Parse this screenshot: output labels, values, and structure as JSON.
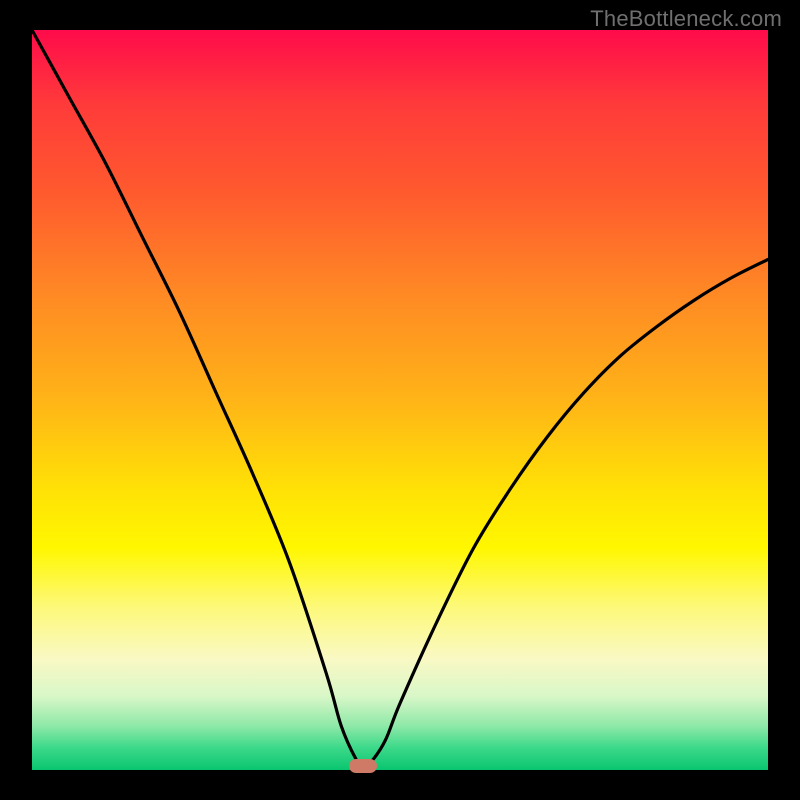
{
  "watermark": {
    "text": "TheBottleneck.com"
  },
  "chart_data": {
    "type": "line",
    "title": "",
    "xlabel": "",
    "ylabel": "",
    "xlim": [
      0,
      100
    ],
    "ylim": [
      0,
      100
    ],
    "grid": false,
    "x": [
      0,
      5,
      10,
      15,
      20,
      25,
      30,
      35,
      40,
      42,
      44,
      45,
      46,
      48,
      50,
      55,
      60,
      65,
      70,
      75,
      80,
      85,
      90,
      95,
      100
    ],
    "values": [
      100,
      91,
      82,
      72,
      62,
      51,
      40,
      28,
      13,
      6,
      1.5,
      0.5,
      1,
      4,
      9,
      20,
      30,
      38,
      45,
      51,
      56,
      60,
      63.5,
      66.5,
      69
    ],
    "marker": {
      "x": 45,
      "y": 0.5
    },
    "series_color": "#000000",
    "marker_color": "#cf7a66"
  }
}
